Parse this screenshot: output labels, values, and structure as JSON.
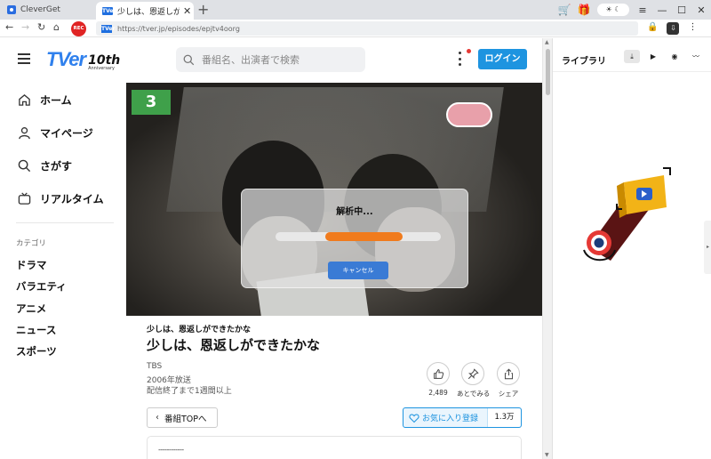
{
  "browser": {
    "app_tab_title": "CleverGet",
    "active_tab_title": "少しは、恩返しができ",
    "active_tab_favicon": "TVer",
    "url": "https://tver.jp/episodes/epjtv4oorg",
    "url_favicon": "TVer",
    "rec_label": "REC",
    "new_tab_icon": "+",
    "accent_color": "#2f80ed"
  },
  "tver": {
    "logo_text": "TVer",
    "anniversary_number": "10th",
    "anniversary_text": "Anniversary",
    "search_placeholder": "番組名、出演者で検索",
    "login_label": "ログイン",
    "login_color": "#1e94e0"
  },
  "sidebar": {
    "main_items": [
      {
        "label": "ホーム",
        "icon": "home-icon"
      },
      {
        "label": "マイページ",
        "icon": "user-icon"
      },
      {
        "label": "さがす",
        "icon": "search-icon"
      },
      {
        "label": "リアルタイム",
        "icon": "tv-icon"
      }
    ],
    "category_title": "カテゴリ",
    "categories": [
      "ドラマ",
      "バラエティ",
      "アニメ",
      "ニュース",
      "スポーツ"
    ]
  },
  "analysis": {
    "title": "解析中...",
    "progress": 0.47,
    "progress_offset": 0.3,
    "progress_color": "#f07b1d",
    "cancel_label": "キャンセル"
  },
  "episode": {
    "subtitle": "少しは、恩返しができたかな",
    "title": "少しは、恩返しができたかな",
    "channel": "TBS",
    "year": "2006年放送",
    "expire": "配信終了まで1週間以上",
    "sticker": "3",
    "like_count": "2,489",
    "later_label": "あとでみる",
    "share_label": "シェア",
    "back_label": "番組TOPへ",
    "favorite_label": "お気に入り登録",
    "favorite_count": "1.3万",
    "description_start": "------------"
  },
  "panel": {
    "title": "ライブラリ",
    "icons": [
      "download-icon",
      "video-icon",
      "audio-icon",
      "podcast-icon"
    ]
  }
}
